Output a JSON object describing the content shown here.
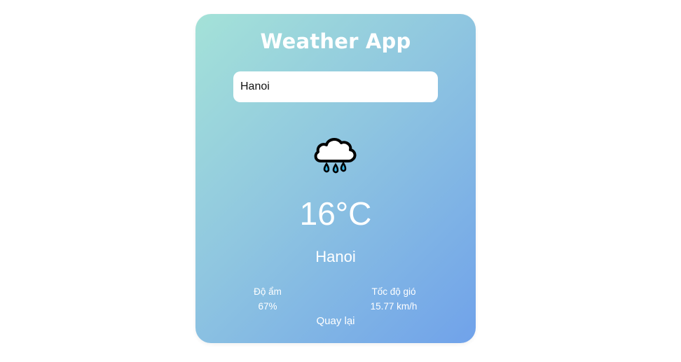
{
  "app": {
    "title": "Weather App"
  },
  "search": {
    "value": "Hanoi"
  },
  "weather": {
    "icon": "rain-cloud-icon",
    "temperature": "16°C",
    "city": "Hanoi",
    "humidity_label": "Độ ẩm",
    "humidity_value": "67%",
    "wind_label": "Tốc độ gió",
    "wind_value": "15.77 km/h"
  },
  "actions": {
    "back_label": "Quay lại"
  },
  "colors": {
    "gradient_start": "#a4e2d8",
    "gradient_end": "#70a2ea",
    "raindrop": "#33b5e5"
  }
}
